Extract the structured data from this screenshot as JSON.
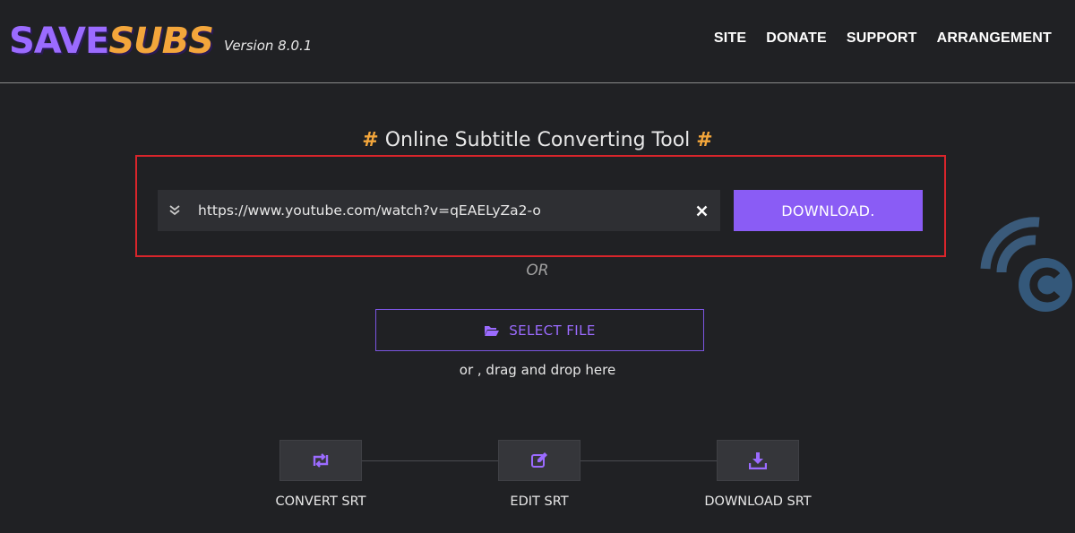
{
  "header": {
    "logo_text_1": "SAVE",
    "logo_text_2": "SUBS",
    "version": "Version 8.0.1",
    "nav": [
      "SITE",
      "DONATE",
      "SUPPORT",
      "ARRANGEMENT"
    ]
  },
  "main": {
    "title": "Online Subtitle Converting Tool",
    "title_hash": "#",
    "url_value": "https://www.youtube.com/watch?v=qEAELyZa2-o",
    "download_label": "DOWNLOAD.",
    "or_label": "OR",
    "select_file_label": "SELECT FILE",
    "drag_text": "or , drag and drop here"
  },
  "steps": [
    {
      "label": "CONVERT SRT",
      "icon": "retweet-icon"
    },
    {
      "label": "EDIT SRT",
      "icon": "edit-icon"
    },
    {
      "label": "DOWNLOAD SRT",
      "icon": "download-icon"
    }
  ],
  "colors": {
    "background": "#202124",
    "accent_purple": "#8a5cf5",
    "accent_orange": "#f3a63b",
    "highlight_red": "#d9252b"
  }
}
